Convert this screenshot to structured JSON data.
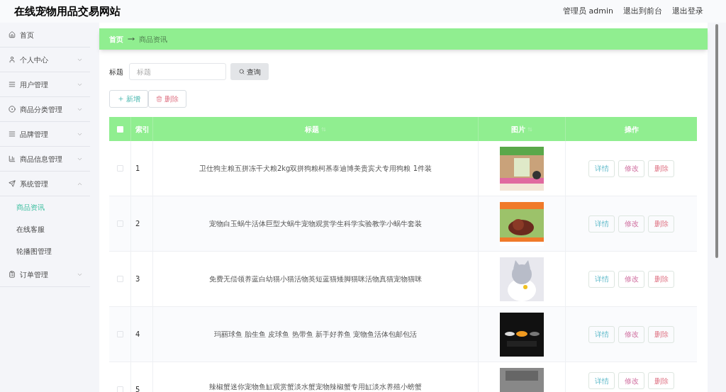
{
  "header": {
    "title": "在线宠物用品交易网站",
    "links": [
      "管理员 admin",
      "退出到前台",
      "退出登录"
    ]
  },
  "sidebar": {
    "items": [
      {
        "label": "首页"
      },
      {
        "label": "个人中心",
        "expanded": false
      },
      {
        "label": "用户管理",
        "expanded": false
      },
      {
        "label": "商品分类管理",
        "expanded": false
      },
      {
        "label": "品牌管理",
        "expanded": false
      },
      {
        "label": "商品信息管理",
        "expanded": false
      },
      {
        "label": "系统管理",
        "expanded": true,
        "children": [
          {
            "label": "商品资讯",
            "selected": true
          },
          {
            "label": "在线客服",
            "selected": false
          },
          {
            "label": "轮播图管理",
            "selected": false
          }
        ]
      },
      {
        "label": "订单管理",
        "expanded": false
      }
    ]
  },
  "breadcrumb": [
    "首页",
    "商品资讯"
  ],
  "search": {
    "label": "标题",
    "placeholder": "标题",
    "button": "查询"
  },
  "actions": [
    "新增",
    "删除"
  ],
  "table": {
    "all_checked": false,
    "columns": [
      "索引",
      "标题",
      "图片",
      "操作"
    ],
    "rows": [
      {
        "index": "1",
        "title": "卫仕狗主粮五拼冻干犬粮2kg双拼狗粮柯基泰迪博美贵宾犬专用狗粮 1件装",
        "checked": false,
        "buttons": [
          "详情",
          "修改",
          "删除"
        ]
      },
      {
        "index": "2",
        "title": "宠物白玉蜗牛活体巨型大蜗牛宠物观赏学生科学实验教学小蜗牛套装",
        "checked": false,
        "buttons": [
          "详情",
          "修改",
          "删除"
        ]
      },
      {
        "index": "3",
        "title": "免费无偿领养蓝白幼猫小猫活物英短蓝猫矮脚猫咪活物真猫宠物猫咪",
        "checked": false,
        "buttons": [
          "详情",
          "修改",
          "删除"
        ]
      },
      {
        "index": "4",
        "title": "玛丽球鱼 胎生鱼 皮球鱼 热带鱼 新手好养鱼 宠物鱼活体包邮包活",
        "checked": false,
        "buttons": [
          "详情",
          "修改",
          "删除"
        ]
      },
      {
        "index": "5",
        "title": "辣椒蟹迷你宠物鱼缸观赏蟹淡水蟹宠物辣椒蟹专用缸淡水养殖小螃蟹",
        "checked": false,
        "buttons": [
          "详情",
          "修改",
          "删除"
        ]
      }
    ]
  }
}
